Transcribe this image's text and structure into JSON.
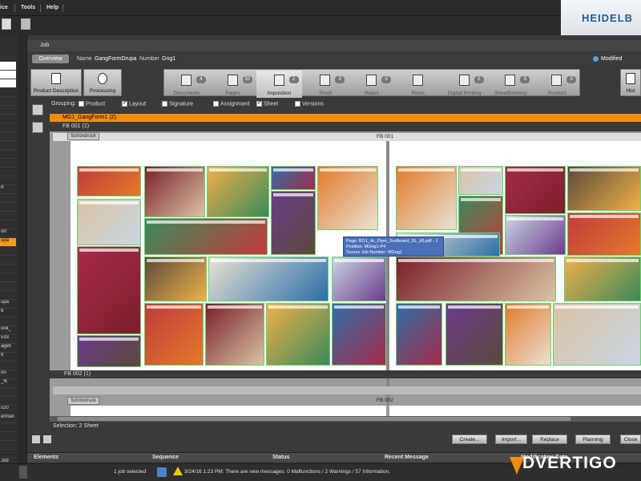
{
  "menu": {
    "items": [
      "ice",
      "Tools",
      "Help"
    ]
  },
  "brand": {
    "name": "HEIDELB"
  },
  "left_panel": {
    "rows": [
      "",
      "",
      "",
      "",
      "",
      "",
      "",
      "",
      "",
      "",
      "",
      "",
      "",
      "",
      "",
      "rt",
      "",
      "",
      "",
      "",
      "ort",
      "upa",
      "",
      "",
      "",
      "",
      "",
      "",
      "upa",
      "9",
      "",
      "ook_",
      "533",
      "agell",
      "9",
      "",
      "on",
      "_N",
      "",
      "",
      "s20",
      "erman",
      "",
      "",
      "",
      "",
      "Job"
    ]
  },
  "job_title": "Job",
  "overview": {
    "tab": "Overview",
    "name_label": "Name",
    "name_value": "GangFormDrupa",
    "number_label": "Number",
    "number_value": "Gng1",
    "modified": "Modified"
  },
  "workflow": {
    "product_description": "Product Description",
    "processing": "Processing",
    "steps": [
      {
        "label": "Documents",
        "badge": "4"
      },
      {
        "label": "Pages",
        "badge": "30"
      },
      {
        "label": "Imposition",
        "badge": "2"
      },
      {
        "label": "Proof",
        "badge": "0"
      },
      {
        "label": "Plates",
        "badge": "0"
      },
      {
        "label": "Press",
        "badge": ""
      },
      {
        "label": "Digital Printing",
        "badge": "0"
      },
      {
        "label": "Sheetfinishing",
        "badge": "5"
      },
      {
        "label": "Product",
        "badge": "0"
      }
    ],
    "history": "Hist"
  },
  "grouping": {
    "label": "Grouping:",
    "options": [
      {
        "label": "Product",
        "checked": false
      },
      {
        "label": "Layout",
        "checked": true
      },
      {
        "label": "Signature",
        "checked": false
      },
      {
        "label": "Assignment",
        "checked": false
      },
      {
        "label": "Sheet",
        "checked": true
      },
      {
        "label": "Versions",
        "checked": false
      }
    ]
  },
  "tree": {
    "root": "MG1_GangForm1 (2)",
    "child1": "FB 001 (1)",
    "child2": "FB 002 (1)"
  },
  "sheet1": {
    "tab": "Schöndruck",
    "label": "FB 001"
  },
  "sheet2": {
    "tab": "Schöndruck",
    "label": "FB 002"
  },
  "tooltip": {
    "line1": "Page: BG1_4c_Flyer_Surfboard_DL_d5.pdf - 1",
    "line2": "Position: MGng1-P4",
    "line3": "Source Job Number: MGng1"
  },
  "selection": "Selection: 2 Sheet",
  "actions": [
    "Create...",
    "Import...",
    "Replace",
    "Planning",
    "Close"
  ],
  "table": {
    "columns": [
      "Elements",
      "Sequence",
      "Status",
      "Recent Message",
      "Modification Date"
    ]
  },
  "status": {
    "job_selected": "1 job selected",
    "message": "3/24/16 1:23 PM: There are new messages: 0 Malfunctions / 2 Warnings / 57 Information."
  },
  "watermark": "DVERTIGO",
  "colors": {
    "accent": "#f28c0f",
    "panel": "#3a3a3a",
    "selection_green": "#6ad16a",
    "tooltip": "#4b6fb8"
  }
}
